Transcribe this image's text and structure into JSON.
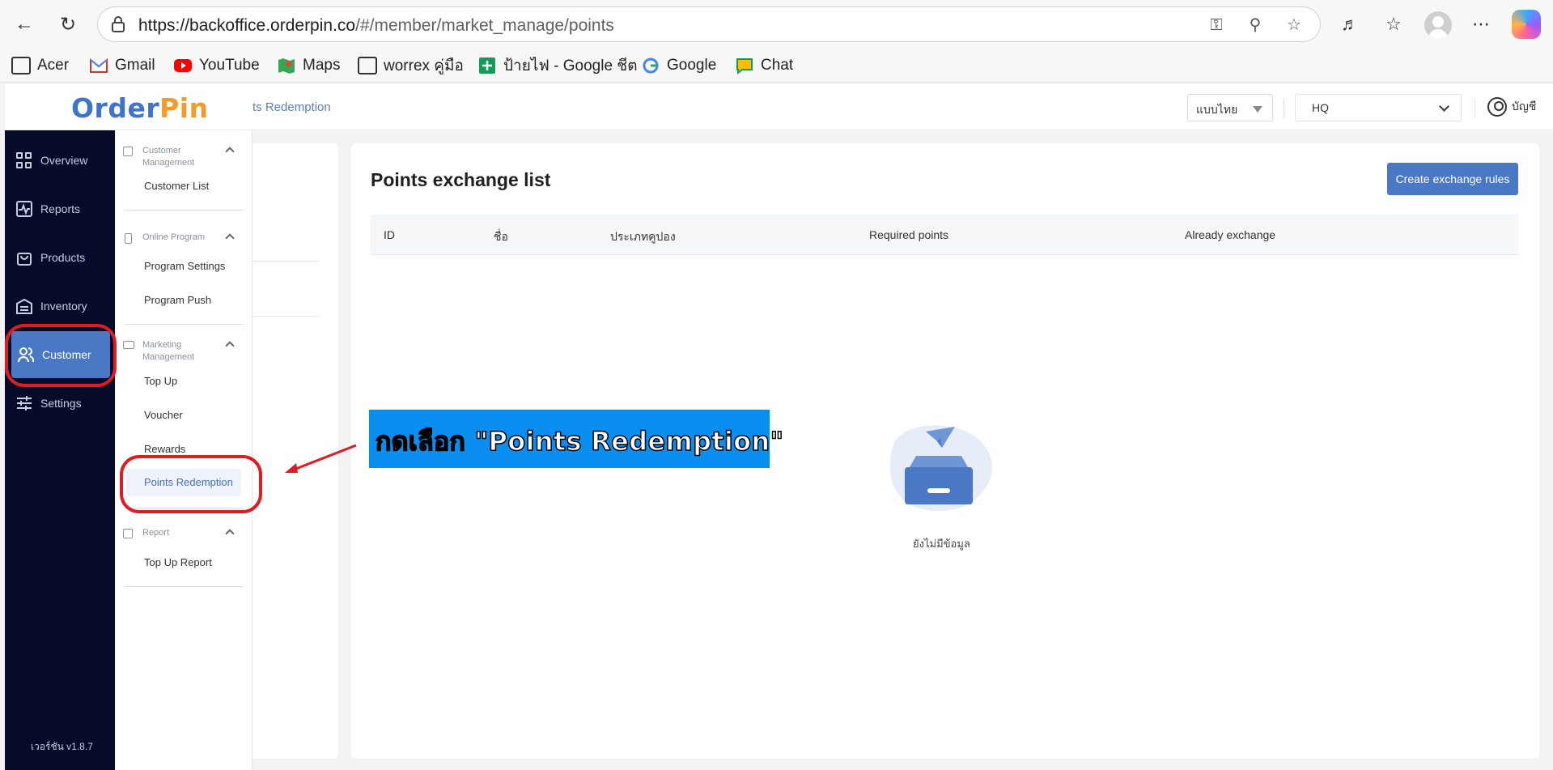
{
  "browser": {
    "url_host": "https://backoffice.orderpin.co",
    "url_path": "/#/member/market_manage/points"
  },
  "bookmarks": [
    {
      "label": "Acer",
      "icon": "folder-icon"
    },
    {
      "label": "Gmail",
      "icon": "gmail-icon"
    },
    {
      "label": "YouTube",
      "icon": "youtube-icon"
    },
    {
      "label": "Maps",
      "icon": "maps-icon"
    },
    {
      "label": "worrex คู่มือ",
      "icon": "folder-icon"
    },
    {
      "label": "ป้ายไฟ - Google ชีต",
      "icon": "sheets-icon"
    },
    {
      "label": "Google",
      "icon": "google-icon"
    },
    {
      "label": "Chat",
      "icon": "chat-icon"
    }
  ],
  "header": {
    "logo_part1": "Order",
    "logo_part2": "Pin",
    "breadcrumb": "ts Redemption",
    "language": "แบบไทย",
    "branch": "HQ",
    "account": "บัญชี"
  },
  "nav": {
    "items": [
      {
        "label": "Overview",
        "icon": "overview-grid-icon"
      },
      {
        "label": "Reports",
        "icon": "reports-chart-icon"
      },
      {
        "label": "Products",
        "icon": "products-bag-icon"
      },
      {
        "label": "Inventory",
        "icon": "inventory-warehouse-icon"
      },
      {
        "label": "Customer",
        "icon": "customer-users-icon"
      },
      {
        "label": "Settings",
        "icon": "settings-sliders-icon"
      }
    ],
    "active": "Customer",
    "version": "เวอร์ชัน v1.8.7"
  },
  "submenu": {
    "group_customer": "Customer Management",
    "customer_list": "Customer List",
    "group_online": "Online Program",
    "program_settings": "Program Settings",
    "program_push": "Program Push",
    "group_marketing": "Marketing Management",
    "top_up": "Top Up",
    "voucher": "Voucher",
    "rewards": "Rewards",
    "points_redemption": "Points Redemption",
    "group_report": "Report",
    "top_up_report": "Top Up Report"
  },
  "main": {
    "title": "Points exchange list",
    "create_button": "Create exchange rules",
    "columns": [
      "ID",
      "ชื่อ",
      "ประเภทคูปอง",
      "Required points",
      "Already exchange"
    ],
    "empty_text": "ยังไม่มีข้อมูล"
  },
  "annotation": {
    "text": "กดเลือก \"Points Redemption\"",
    "color": "#e11b22",
    "box_color": "#0a8ef0"
  }
}
